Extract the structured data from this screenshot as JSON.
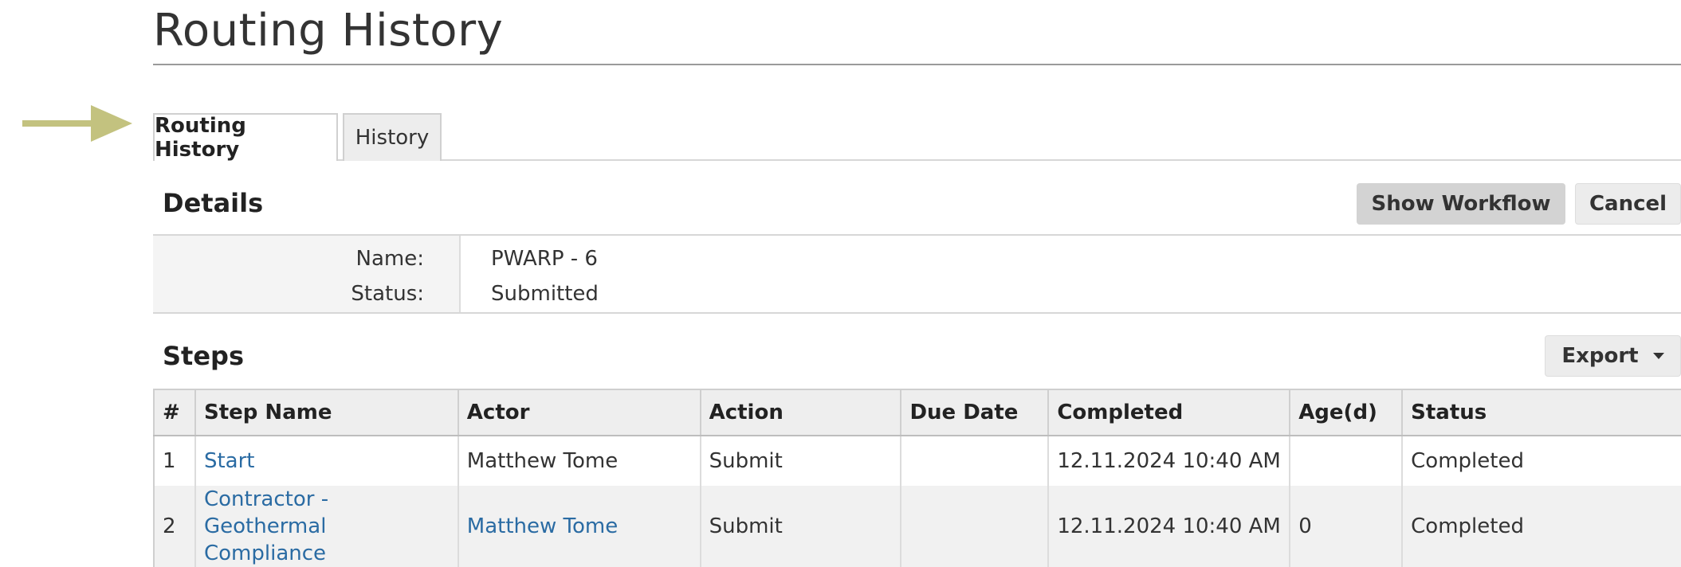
{
  "page": {
    "title": "Routing History"
  },
  "tabs": [
    {
      "label": "Routing History",
      "active": true
    },
    {
      "label": "History",
      "active": false
    }
  ],
  "details": {
    "title": "Details",
    "show_workflow_label": "Show Workflow",
    "cancel_label": "Cancel",
    "name_label": "Name:",
    "name_value": "PWARP - 6",
    "status_label": "Status:",
    "status_value": "Submitted"
  },
  "steps": {
    "title": "Steps",
    "export_label": "Export",
    "columns": [
      "#",
      "Step Name",
      "Actor",
      "Action",
      "Due Date",
      "Completed",
      "Age(d)",
      "Status"
    ],
    "rows": [
      {
        "num": "1",
        "step_name": "Start",
        "actor": "Matthew Tome",
        "action": "Submit",
        "due_date": "",
        "completed": "12.11.2024 10:40 AM",
        "age": "",
        "status": "Completed"
      },
      {
        "num": "2",
        "step_name": "Contractor - Geothermal Compliance",
        "actor": "Matthew Tome",
        "action": "Submit",
        "due_date": "",
        "completed": "12.11.2024 10:40 AM",
        "age": "0",
        "status": "Completed"
      }
    ]
  },
  "colors": {
    "arrow": "#c3c27f",
    "link": "#2a6ba3"
  },
  "icons": {
    "tab_pointer": "arrow-right-icon",
    "export_caret": "caret-down-icon"
  }
}
